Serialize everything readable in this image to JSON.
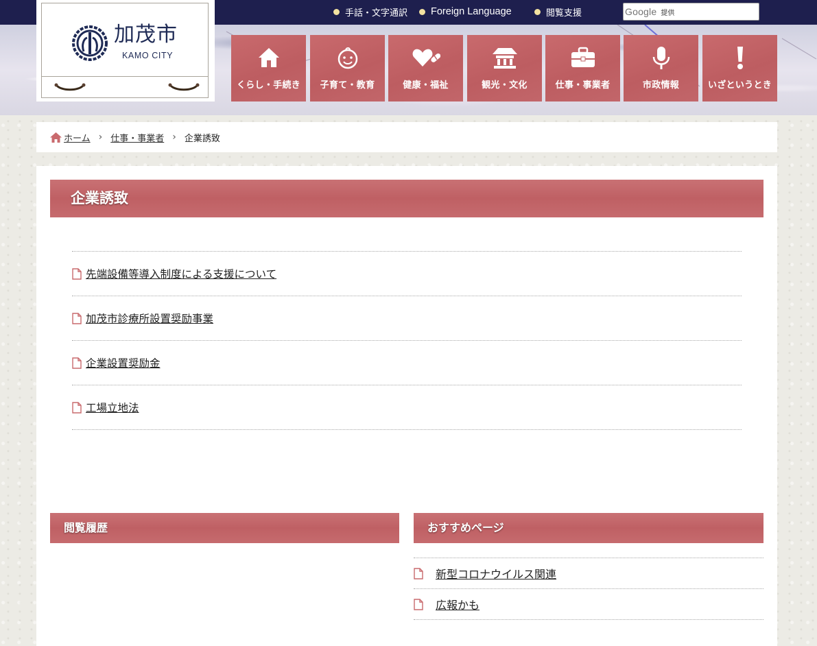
{
  "header": {
    "utility_links": [
      {
        "label": "手話・文字通訳"
      },
      {
        "label": "Foreign Language"
      },
      {
        "label": "閲覧支援"
      }
    ],
    "search": {
      "brand": "Google",
      "provided_by": "提供"
    },
    "logo": {
      "name_ja": "加茂市",
      "name_en": "KAMO CITY"
    }
  },
  "nav": {
    "items": [
      {
        "label": "くらし・手続き",
        "icon": "house-icon"
      },
      {
        "label": "子育て・教育",
        "icon": "child-face-icon"
      },
      {
        "label": "健康・福祉",
        "icon": "heart-pill-icon"
      },
      {
        "label": "観光・文化",
        "icon": "temple-icon"
      },
      {
        "label": "仕事・事業者",
        "icon": "briefcase-icon"
      },
      {
        "label": "市政情報",
        "icon": "microphone-icon"
      },
      {
        "label": "いざというとき",
        "icon": "exclamation-icon"
      }
    ]
  },
  "breadcrumb": {
    "home": "ホーム",
    "parent": "仕事・事業者",
    "current": "企業誘致"
  },
  "main": {
    "title": "企業誘致",
    "links": [
      {
        "label": "先端設備等導入制度による支援について"
      },
      {
        "label": "加茂市診療所設置奨励事業"
      },
      {
        "label": "企業設置奨励金"
      },
      {
        "label": "工場立地法"
      }
    ],
    "history_title": "閲覧履歴",
    "recommended_title": "おすすめページ",
    "recommended": [
      {
        "label": "新型コロナウイルス関連"
      },
      {
        "label": "広報かも"
      }
    ]
  },
  "colors": {
    "header_bar": "#1e1f4e",
    "accent": "#bf6064",
    "dot": "#f3e2a1",
    "logo_navy": "#1e2a55"
  }
}
